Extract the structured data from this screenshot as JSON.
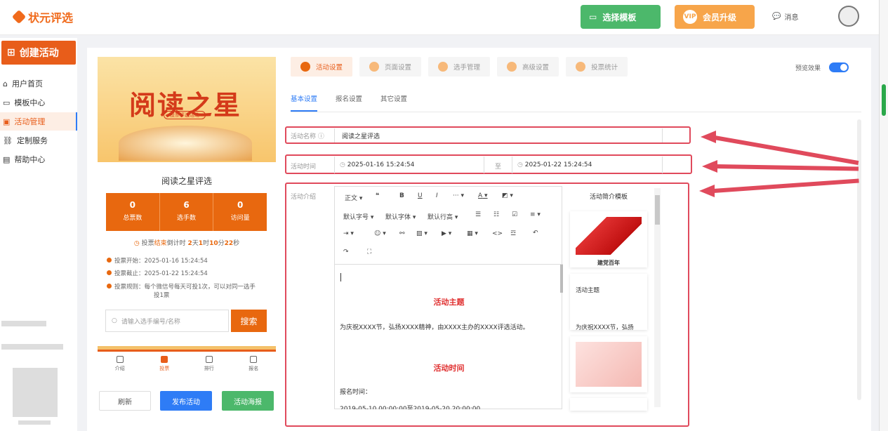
{
  "topbar": {
    "logo_text": "状元评选",
    "template_button": "选择模板",
    "upgrade_button": "会员升级",
    "vip_badge": "VIP",
    "messages_label": "消息"
  },
  "sidebar": {
    "create_button": "创建活动",
    "items": [
      {
        "label": "用户首页",
        "icon": "home-icon"
      },
      {
        "label": "模板中心",
        "icon": "folder-icon"
      },
      {
        "label": "活动管理",
        "icon": "ticket-icon"
      },
      {
        "label": "定制服务",
        "icon": "link-icon"
      },
      {
        "label": "帮助中心",
        "icon": "doc-icon"
      }
    ],
    "active_index": 2
  },
  "preview": {
    "banner_title": "阅读之星",
    "banner_tag": "投票评选活动",
    "card_title": "阅读之星评选",
    "stats": [
      {
        "value": "0",
        "label": "总票数"
      },
      {
        "value": "6",
        "label": "选手数"
      },
      {
        "value": "0",
        "label": "访问量"
      }
    ],
    "countdown_prefix": "投票",
    "countdown_strong": "结束",
    "countdown_text": "倒计时",
    "countdown_values": [
      "2",
      "1",
      "10",
      "22"
    ],
    "countdown_units": [
      "天",
      "时",
      "分",
      "秒"
    ],
    "vote_start": "投票开始：2025-01-16 15:24:54",
    "vote_end": "投票截止：2025-01-22 15:24:54",
    "vote_rule_1": "投票规则：每个微信号每天可投1次，可以对同一选手",
    "vote_rule_2": "投1票",
    "search_placeholder": "请输入选手编号/名称",
    "search_button": "搜索",
    "bottom_nav": [
      "介绍",
      "投票",
      "排行",
      "报名"
    ]
  },
  "actions": {
    "refresh": "刷新",
    "publish": "发布活动",
    "poster": "活动海报"
  },
  "tabs": [
    "活动设置",
    "页面设置",
    "选手管理",
    "高级设置",
    "投票统计"
  ],
  "preview_toggle_label": "预览效果",
  "subtabs": [
    "基本设置",
    "报名设置",
    "其它设置"
  ],
  "form": {
    "name_label": "活动名称",
    "name_value": "阅读之星评选",
    "time_label": "活动时间",
    "start_time": "2025-01-16 15:24:54",
    "to_label": "至",
    "end_time": "2025-01-22 15:24:54",
    "intro_label": "活动介绍"
  },
  "editor": {
    "toolbar_row1": [
      "正文",
      "❝",
      "B",
      "U",
      "I",
      "···",
      "A",
      "A"
    ],
    "toolbar_row2": [
      "默认字号",
      "默认字体",
      "默认行高"
    ],
    "h_theme": "活动主题",
    "p_theme": "为庆祝XXXX节，弘扬XXXX精神，由XXXX主办的XXXX评选活动。",
    "h_time": "活动时间",
    "p_signup": "报名时间：",
    "p_signup_value": "2019-05-10 00:00:00至2019-05-20 20:00:00"
  },
  "template_panel": {
    "title": "活动简介模板",
    "card1_caption": "建党百年",
    "card2_title": "活动主题",
    "card2_text": "为庆祝XXXX节，弘扬"
  },
  "colors": {
    "brand": "#e85d1a",
    "accent": "#2e7cf6",
    "green": "#4cb86b",
    "highlight": "#e04a5c"
  }
}
